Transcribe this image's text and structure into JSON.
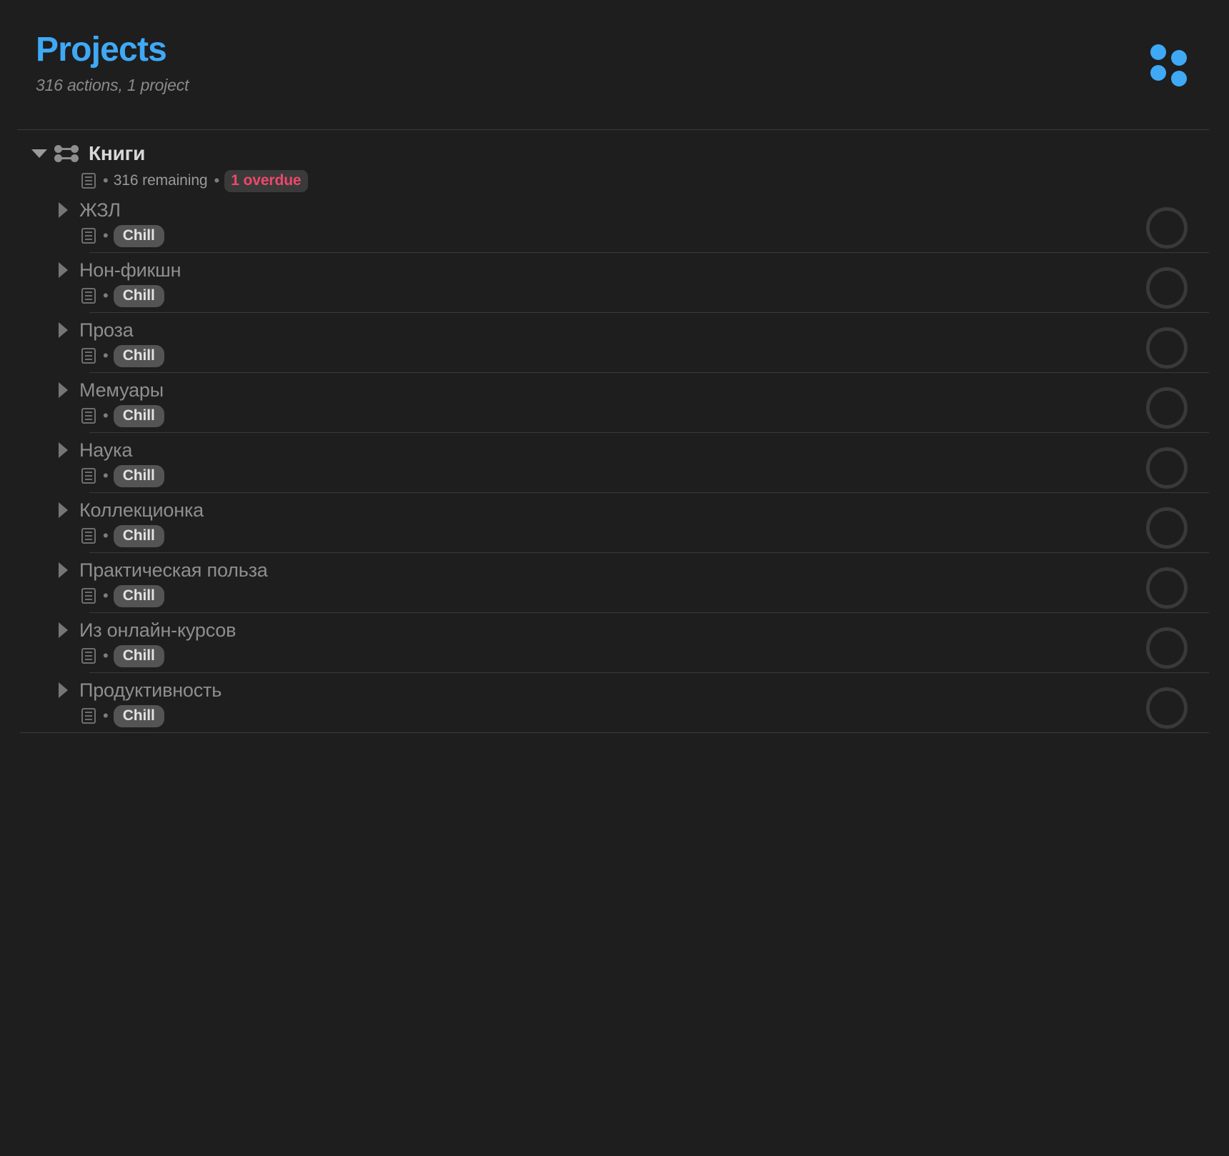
{
  "header": {
    "title": "Projects",
    "subtitle": "316 actions, 1 project",
    "grid_icon": "grid-dots-icon",
    "accent_color": "#3fa9f5"
  },
  "project": {
    "name": "Книги",
    "icon": "parallel-project-icon",
    "disclosure": "chevron-down-icon",
    "note_icon": "note-icon",
    "separator": "•",
    "remaining": "316 remaining",
    "overdue_badge": "1 overdue",
    "overdue_color": "#f0476b",
    "children": [
      {
        "name": "ЖЗЛ",
        "note_icon": "note-icon",
        "separator": "•",
        "tag": "Chill",
        "disclosure": "chevron-right-icon",
        "checkbox": "status-circle"
      },
      {
        "name": "Нон-фикшн",
        "note_icon": "note-icon",
        "separator": "•",
        "tag": "Chill",
        "disclosure": "chevron-right-icon",
        "checkbox": "status-circle"
      },
      {
        "name": "Проза",
        "note_icon": "note-icon",
        "separator": "•",
        "tag": "Chill",
        "disclosure": "chevron-right-icon",
        "checkbox": "status-circle"
      },
      {
        "name": "Мемуары",
        "note_icon": "note-icon",
        "separator": "•",
        "tag": "Chill",
        "disclosure": "chevron-right-icon",
        "checkbox": "status-circle"
      },
      {
        "name": "Наука",
        "note_icon": "note-icon",
        "separator": "•",
        "tag": "Chill",
        "disclosure": "chevron-right-icon",
        "checkbox": "status-circle"
      },
      {
        "name": "Коллекционка",
        "note_icon": "note-icon",
        "separator": "•",
        "tag": "Chill",
        "disclosure": "chevron-right-icon",
        "checkbox": "status-circle"
      },
      {
        "name": "Практическая польза",
        "note_icon": "note-icon",
        "separator": "•",
        "tag": "Chill",
        "disclosure": "chevron-right-icon",
        "checkbox": "status-circle"
      },
      {
        "name": "Из онлайн-курсов",
        "note_icon": "note-icon",
        "separator": "•",
        "tag": "Chill",
        "disclosure": "chevron-right-icon",
        "checkbox": "status-circle"
      },
      {
        "name": "Продуктивность",
        "note_icon": "note-icon",
        "separator": "•",
        "tag": "Chill",
        "disclosure": "chevron-right-icon",
        "checkbox": "status-circle"
      }
    ]
  }
}
